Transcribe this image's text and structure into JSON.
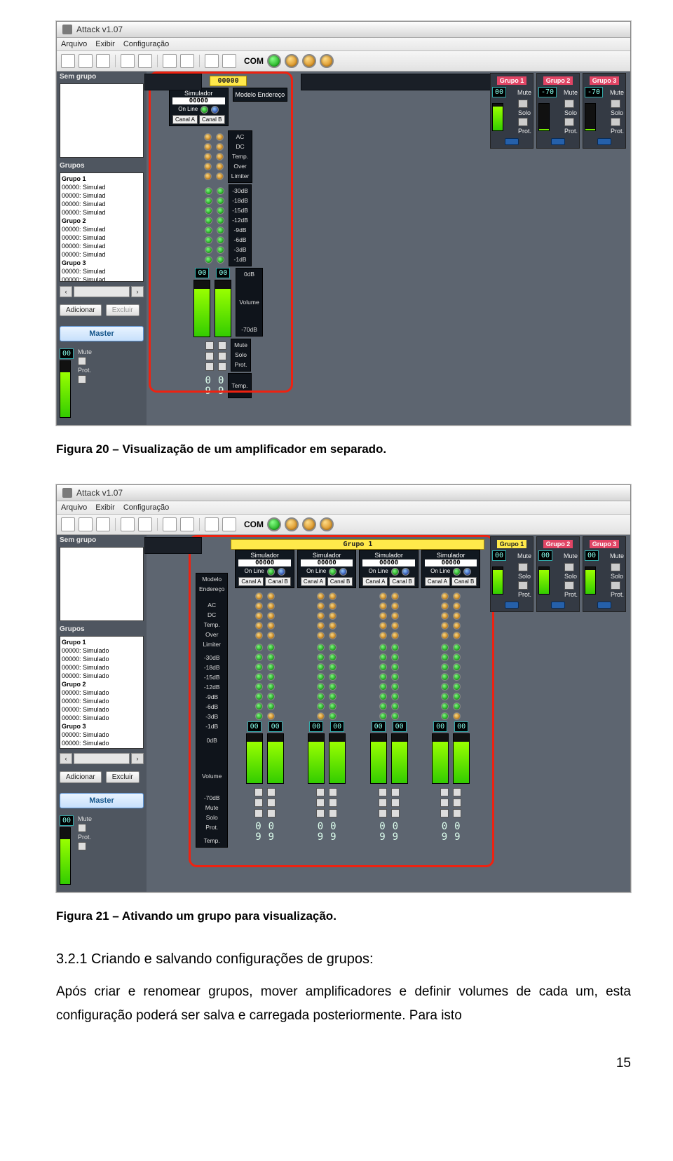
{
  "app": {
    "title": "Attack v1.07",
    "menus": [
      "Arquivo",
      "Exibir",
      "Configuração"
    ],
    "com_label": "COM"
  },
  "sidebar": {
    "sem_grupo": "Sem grupo",
    "grupos_label": "Grupos",
    "groups": [
      "Grupo 1",
      "Grupo 2",
      "Grupo 3"
    ],
    "item_text": "00000: Simulad",
    "adicionar": "Adicionar",
    "excluir": "Excluir",
    "master": "Master",
    "master_val": "00",
    "master_labels": [
      "Mute",
      "Prot."
    ]
  },
  "amp": {
    "tag": "00000",
    "sim_label": "Simulador",
    "sim_num": "00000",
    "model_label": "Modelo",
    "endereco_label": "Endereço",
    "online_label": "On Line",
    "channels": [
      "Canal A",
      "Canal B"
    ],
    "status_labels": [
      "AC",
      "DC",
      "Temp.",
      "Over",
      "Limiter"
    ],
    "db_labels": [
      "-30dB",
      "-18dB",
      "-15dB",
      "-12dB",
      "-9dB",
      "-6dB",
      "-3dB",
      "-1dB"
    ],
    "vol_00": "00",
    "zero_db": "0dB",
    "volume": "Volume",
    "m70": "-70dB",
    "bottom_labels": [
      "Mute",
      "Solo",
      "Prot."
    ],
    "big9_top": "0",
    "big9_bot": "9",
    "temp": "Temp."
  },
  "group_panels": {
    "titles": [
      "Grupo 1",
      "Grupo 2",
      "Grupo 3"
    ],
    "val_00": "00",
    "val_m70": "-70",
    "labels": [
      "Mute",
      "Solo",
      "Prot."
    ]
  },
  "shot2": {
    "group1_title": "Grupo 1",
    "item_text": "00000: Simulado"
  },
  "captions": {
    "fig20": "Figura 20 – Visualização de um amplificador em separado.",
    "fig21": "Figura 21 – Ativando um grupo para visualização."
  },
  "section": {
    "title": "3.2.1  Criando e salvando configurações de grupos:",
    "body": "Após criar e renomear grupos, mover amplificadores e definir volumes de cada um, esta configuração poderá ser salva e carregada posteriormente. Para isto"
  },
  "pagenum": "15"
}
